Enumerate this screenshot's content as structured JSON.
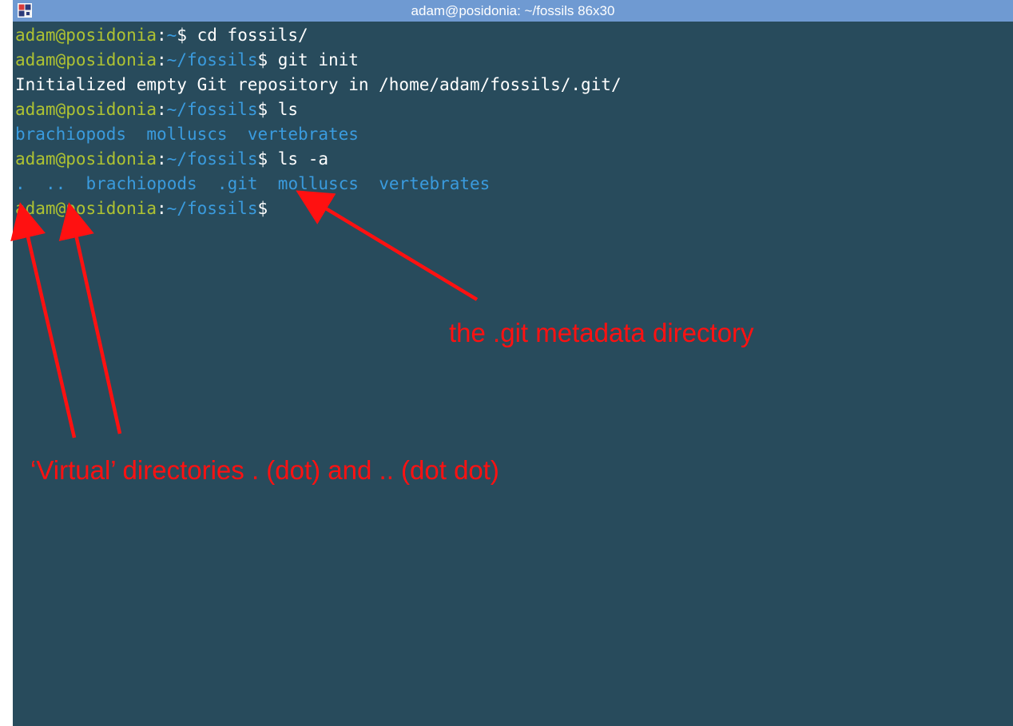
{
  "window": {
    "title": "adam@posidonia: ~/fossils 86x30",
    "icon": "terminal-app-icon"
  },
  "terminal": {
    "lines": [
      {
        "user": "adam@posidonia",
        "colon": ":",
        "path": "~",
        "dollar": "$ ",
        "command": "cd fossils/"
      },
      {
        "user": "adam@posidonia",
        "colon": ":",
        "path": "~/fossils",
        "dollar": "$ ",
        "command": "git init"
      },
      {
        "output": "Initialized empty Git repository in /home/adam/fossils/.git/"
      },
      {
        "user": "adam@posidonia",
        "colon": ":",
        "path": "~/fossils",
        "dollar": "$ ",
        "command": "ls"
      },
      {
        "entries": [
          "brachiopods",
          "molluscs",
          "vertebrates"
        ]
      },
      {
        "user": "adam@posidonia",
        "colon": ":",
        "path": "~/fossils",
        "dollar": "$ ",
        "command": "ls -a"
      },
      {
        "entries": [
          ".",
          "..",
          "brachiopods",
          ".git",
          "molluscs",
          "vertebrates"
        ]
      },
      {
        "user": "adam@posidonia",
        "colon": ":",
        "path": "~/fossils",
        "dollar": "$",
        "command": ""
      }
    ]
  },
  "annotations": {
    "git_label": "the .git metadata directory",
    "virtual_label": "‘Virtual’ directories . (dot) and .. (dot dot)",
    "color": "#ff1111"
  },
  "colors": {
    "titlebar": "#6f9ad2",
    "terminal_bg": "#284b5c",
    "prompt_user": "#aec232",
    "prompt_path": "#3a9bde",
    "directory": "#3a9bde",
    "text": "#ffffff"
  }
}
